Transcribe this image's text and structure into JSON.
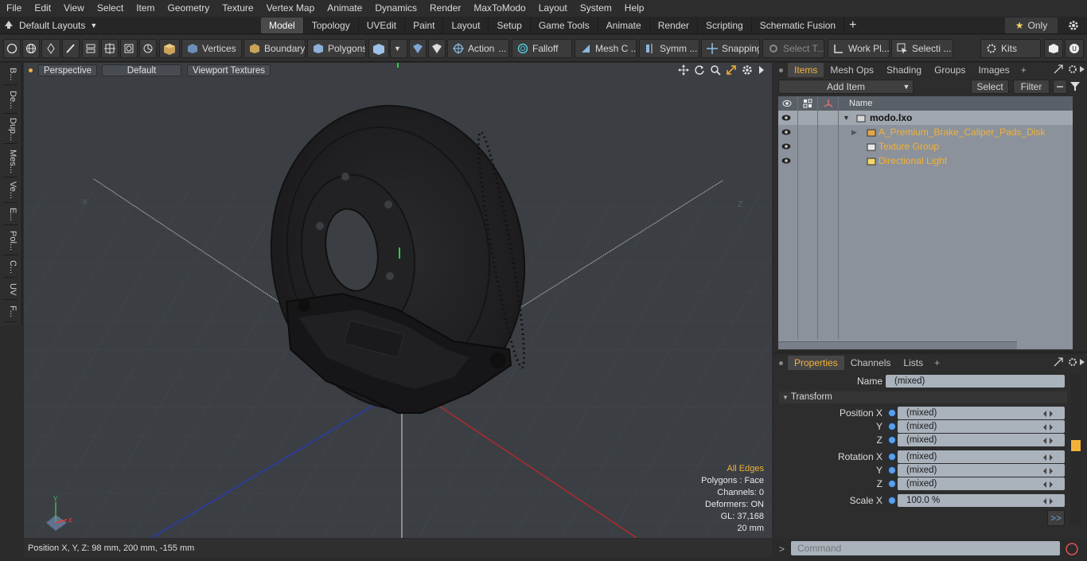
{
  "menu": [
    "File",
    "Edit",
    "View",
    "Select",
    "Item",
    "Geometry",
    "Texture",
    "Vertex Map",
    "Animate",
    "Dynamics",
    "Render",
    "MaxToModo",
    "Layout",
    "System",
    "Help"
  ],
  "layouts": {
    "label": "Default Layouts"
  },
  "tabs": [
    "Model",
    "Topology",
    "UVEdit",
    "Paint",
    "Layout",
    "Setup",
    "Game Tools",
    "Animate",
    "Render",
    "Scripting",
    "Schematic Fusion"
  ],
  "only_label": "Only",
  "toolbar": {
    "vertices": "Vertices",
    "boundary": "Boundary",
    "polygons": "Polygons",
    "action": "Action",
    "falloff": "Falloff",
    "mesh": "Mesh C ...",
    "symm": "Symm ...",
    "snapping": "Snapping",
    "select_t": "Select T...",
    "work_pl": "Work Pl...",
    "selecti": "Selecti ...",
    "kits": "Kits"
  },
  "left_tabs": [
    "B...",
    "De...",
    "Dup...",
    "Mes...",
    "Ve...",
    "E...",
    "Pol...",
    "C...",
    "UV",
    "F..."
  ],
  "viewport": {
    "perspective": "Perspective",
    "default": "Default",
    "textures": "Viewport Textures",
    "axis_neg_x": "-X",
    "axis_z": "Z",
    "gizmo_y": "Y",
    "gizmo_x": "X",
    "info": {
      "edges": "All Edges",
      "polygons": "Polygons : Face",
      "channels": "Channels: 0",
      "deformers": "Deformers: ON",
      "gl": "GL: 37,168",
      "scale": "20 mm"
    }
  },
  "status": "Position X, Y, Z:  98 mm, 200 mm, -155 mm",
  "items_panel": {
    "tabs": [
      "Items",
      "Mesh Ops",
      "Shading",
      "Groups",
      "Images"
    ],
    "add_item": "Add Item",
    "select": "Select",
    "filter": "Filter",
    "col_name": "Name",
    "rows": [
      {
        "name": "modo.lxo",
        "kind": "scene"
      },
      {
        "name": "A_Premium_Brake_Caliper_Pads_Disk",
        "kind": "mesh"
      },
      {
        "name": "Texture Group",
        "kind": "group"
      },
      {
        "name": "Directional Light",
        "kind": "light"
      }
    ]
  },
  "properties_panel": {
    "tabs": [
      "Properties",
      "Channels",
      "Lists"
    ],
    "name_label": "Name",
    "name_value": "(mixed)",
    "section": "Transform",
    "rows": [
      {
        "label": "Position X",
        "value": "(mixed)"
      },
      {
        "label": "Y",
        "value": "(mixed)"
      },
      {
        "label": "Z",
        "value": "(mixed)"
      },
      {
        "label": "Rotation X",
        "value": "(mixed)"
      },
      {
        "label": "Y",
        "value": "(mixed)"
      },
      {
        "label": "Z",
        "value": "(mixed)"
      },
      {
        "label": "Scale X",
        "value": "100.0 %"
      }
    ],
    "more": ">>"
  },
  "command": {
    "placeholder": "Command"
  },
  "colors": {
    "accent": "#f2b23a",
    "viewport_bg": "#3b3f44",
    "panel_list": "#8b929b"
  }
}
